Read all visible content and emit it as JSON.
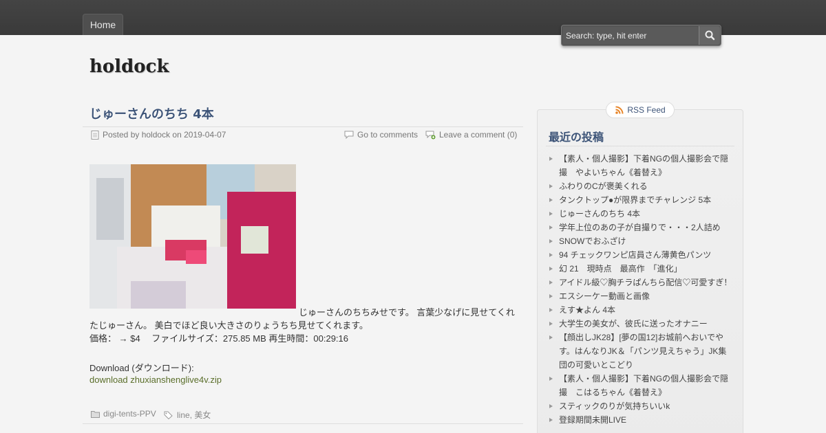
{
  "nav": {
    "home_label": "Home"
  },
  "search": {
    "placeholder": "Search: type, hit enter"
  },
  "site": {
    "title": "holdock"
  },
  "post": {
    "title": "じゅーさんのちち 4本",
    "posted_by_prefix": "Posted by ",
    "author": "holdock",
    "posted_on": " on ",
    "date": "2019-04-07",
    "go_to_comments": "Go to comments",
    "leave_comment": "Leave a comment (0)",
    "body_line1": "じゅーさんのちちみせです。 言葉少なげに見せてくれ",
    "body_line2": "たじゅーさん。 美白でほど良い大きさのりょうちち見せてくれます。",
    "body_line3": "価格： → $4　 ファイルサイズ：275.85 MB 再生時間：00:29:16",
    "download_title": "Download (ダウンロード):",
    "download_link": "download zhuxianshenglive4v.zip",
    "category": "digi-tents-PPV",
    "tags": [
      {
        "label": "line"
      },
      {
        "label": "美女"
      }
    ]
  },
  "sidebar": {
    "rss_label": "RSS Feed",
    "widget_title": "最近の投稿",
    "recent_posts": [
      "【素人・個人撮影】下着NGの個人撮影会で隠撮　やよいちゃん《着替え》",
      "ふわりのCが褒美くれる",
      "タンクトップ●が限界までチャレンジ 5本",
      "じゅーさんのちち 4本",
      "学年上位のあの子が自撮りで・・・2人詰め",
      "SNOWでおふざけ",
      "94 チェックワンピ店員さん薄黄色パンツ",
      "幻 21　現時点　最高作　「進化」",
      "アイドル級♡胸チラぱんちら配信♡可愛すぎ！",
      "エスシーケー動画と画像",
      "えす★よん 4本",
      "大学生の美女が、彼氏に送ったオナニー",
      "【顔出しJK28】[夢の国12]お城前へおいでや す。はんなりJK＆「パンツ見えちゃう」JK集団の可愛いとこどり",
      "【素人・個人撮影】下着NGの個人撮影会で隠撮　こはるちゃん《着替え》",
      "スティックのりが気持ちいいk",
      "登録期間未開LIVE"
    ]
  },
  "icons": {
    "search": "search-icon",
    "post": "document-icon",
    "comments": "speech-bubble-icon",
    "add_comment": "add-comment-icon",
    "category": "folder-icon",
    "tags": "tag-icon",
    "rss": "rss-icon"
  },
  "colors": {
    "topbar": "#404040",
    "title_blue": "#3d5478",
    "link_green": "#5a6e2a"
  }
}
